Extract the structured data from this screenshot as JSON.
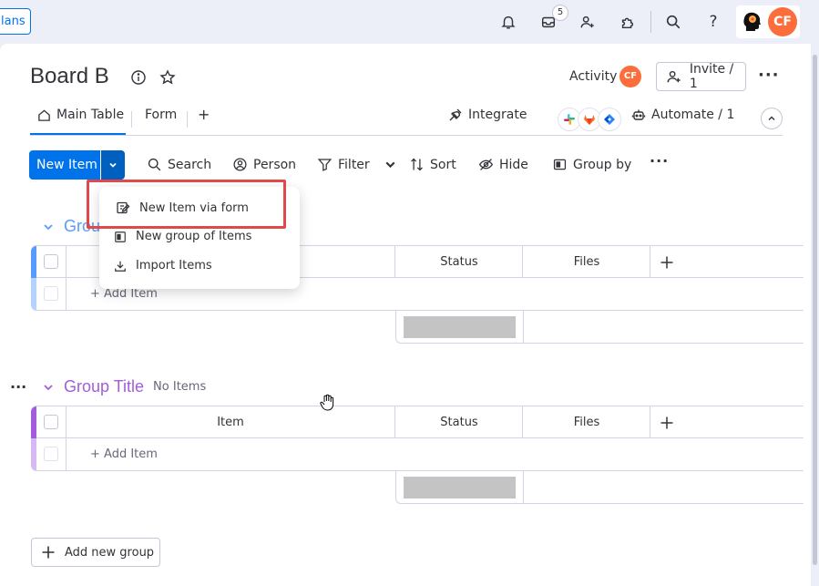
{
  "topbar": {
    "plans_label": "lans",
    "inbox_badge": "5",
    "avatar_initials": "CF"
  },
  "board": {
    "title": "Board B",
    "activity_label": "Activity",
    "activity_initials": "CF",
    "invite_label": "Invite / 1"
  },
  "tabs": {
    "main_table": "Main Table",
    "form": "Form",
    "add": "+",
    "integrate": "Integrate",
    "automate": "Automate / 1"
  },
  "toolbar": {
    "new_item": "New Item",
    "search": "Search",
    "person": "Person",
    "filter": "Filter",
    "sort": "Sort",
    "hide": "Hide",
    "group_by": "Group by"
  },
  "dropdown": {
    "item1": "New Item via form",
    "item2": "New group of Items",
    "item3": "Import Items"
  },
  "groups": [
    {
      "title": "Grou",
      "color": "#579bfc",
      "light": "#b4d3fb",
      "col_status": "Status",
      "col_files": "Files",
      "add_item": "+ Add Item"
    },
    {
      "title": "Group Title",
      "count": "No Items",
      "color": "#a25ddc",
      "light": "#d7b8f0",
      "col_item": "Item",
      "col_status": "Status",
      "col_files": "Files",
      "add_item": "+ Add Item"
    }
  ],
  "footer": {
    "add_group": "Add new group"
  }
}
